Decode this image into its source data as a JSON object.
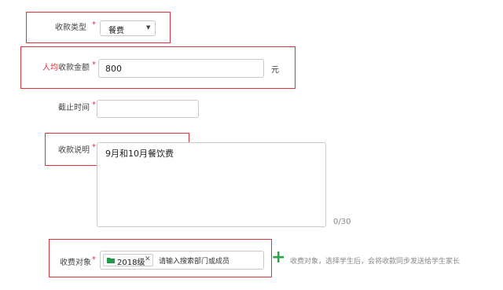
{
  "form": {
    "type": {
      "label": "收款类型",
      "required_mark": "*",
      "value": "餐费",
      "arrow": "▼"
    },
    "amount": {
      "label_highlight": "人均",
      "label_rest": "收款金额",
      "required_mark": "*",
      "value": "800",
      "unit": "元"
    },
    "deadline": {
      "label": "截止时间",
      "required_mark": "*",
      "value": ""
    },
    "description": {
      "label": "收款说明",
      "required_mark": "*",
      "value": "9月和10月餐饮费",
      "counter": "0/30"
    },
    "targets": {
      "label": "收费对象",
      "required_mark": "*",
      "tag": {
        "text": "2018级",
        "remove": "✕"
      },
      "placeholder": "请输入搜索部门或成员",
      "add_symbol": "+",
      "hint": "收费对象，选择学生后，会将收款同步发送给学生家长"
    }
  },
  "colors": {
    "highlight": "#e0313a",
    "accent": "#2aa54a",
    "folder": "#1f9b4a"
  }
}
